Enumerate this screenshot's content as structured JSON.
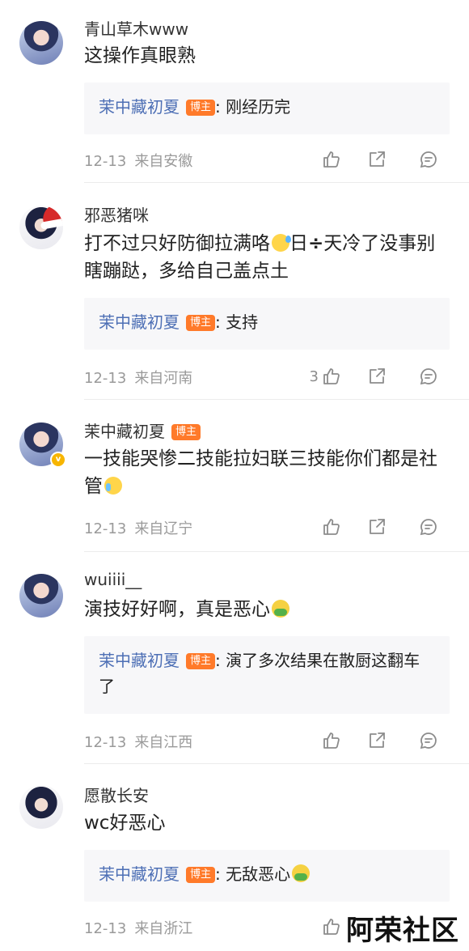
{
  "comments": [
    {
      "username": "青山草木www",
      "text": "这操作真眼熟",
      "reply": {
        "author": "茉中藏初夏",
        "badge": "博主",
        "text": ": 刚经历完"
      },
      "date": "12-13",
      "location": "来自安徽",
      "likes": ""
    },
    {
      "username": "邪恶猪咪",
      "text_parts": [
        "打不过只好防御拉满咯",
        "日",
        "÷",
        "天冷了没事别瞎蹦跶，多给自己盖点土"
      ],
      "reply": {
        "author": "茉中藏初夏",
        "badge": "博主",
        "text": ": 支持"
      },
      "date": "12-13",
      "location": "来自河南",
      "likes": "3"
    },
    {
      "username": "茉中藏初夏",
      "badge": "博主",
      "text": "一技能哭惨二技能拉妇联三技能你们都是社管",
      "date": "12-13",
      "location": "来自辽宁",
      "likes": ""
    },
    {
      "username": "wuiiii__",
      "text": "演技好好啊，真是恶心",
      "reply": {
        "author": "茉中藏初夏",
        "badge": "博主",
        "text": ": 演了多次结果在散厨这翻车了"
      },
      "date": "12-13",
      "location": "来自江西",
      "likes": ""
    },
    {
      "username": "愿散长安",
      "text": "wc好恶心",
      "reply": {
        "author": "茉中藏初夏",
        "badge": "博主",
        "text": ": 无敌恶心"
      },
      "date": "12-13",
      "location": "来自浙江",
      "likes": ""
    }
  ],
  "watermark": "阿荣社区",
  "icons": {
    "like": "thumbs-up-icon",
    "share": "share-icon",
    "comment": "comment-icon"
  },
  "colors": {
    "reply_name": "#4d6fb5",
    "badge": "#ff7a2a",
    "reply_bg": "#f7f7f9"
  }
}
